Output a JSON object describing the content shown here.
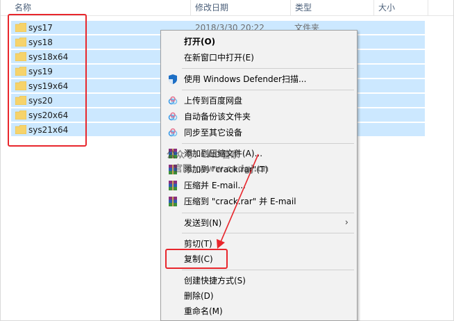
{
  "columns": {
    "name": "名称",
    "date": "修改日期",
    "type": "类型",
    "size": "大小"
  },
  "files": [
    {
      "name": "sys17",
      "date": "2018/3/30 20:22",
      "type": "文件夹"
    },
    {
      "name": "sys18"
    },
    {
      "name": "sys18x64"
    },
    {
      "name": "sys19"
    },
    {
      "name": "sys19x64"
    },
    {
      "name": "sys20"
    },
    {
      "name": "sys20x64"
    },
    {
      "name": "sys21x64"
    }
  ],
  "menu": {
    "open": "打开(O)",
    "open_new_window": "在新窗口中打开(E)",
    "defender": "使用 Windows Defender扫描...",
    "upload_baidu": "上传到百度网盘",
    "auto_backup": "自动备份该文件夹",
    "sync_device": "同步至其它设备",
    "add_archive": "添加到压缩文件(A)...",
    "add_crack": "添加到 \"crack.rar\"(T)",
    "compress_email": "压缩并 E-mail...",
    "compress_crack_email": "压缩到 \"crack.rar\" 并 E-mail",
    "send_to": "发送到(N)",
    "cut": "剪切(T)",
    "copy": "复制(C)",
    "create_shortcut": "创建快捷方式(S)",
    "delete": "删除(D)",
    "rename": "重命名(M)"
  },
  "watermark": {
    "line1": "公众号: CAD管家",
    "line2": "官网: www.cadgj.cn"
  },
  "colors": {
    "selection": "#cce8ff",
    "annotation": "#e8262c",
    "menu_bg": "#f2f2f2"
  }
}
